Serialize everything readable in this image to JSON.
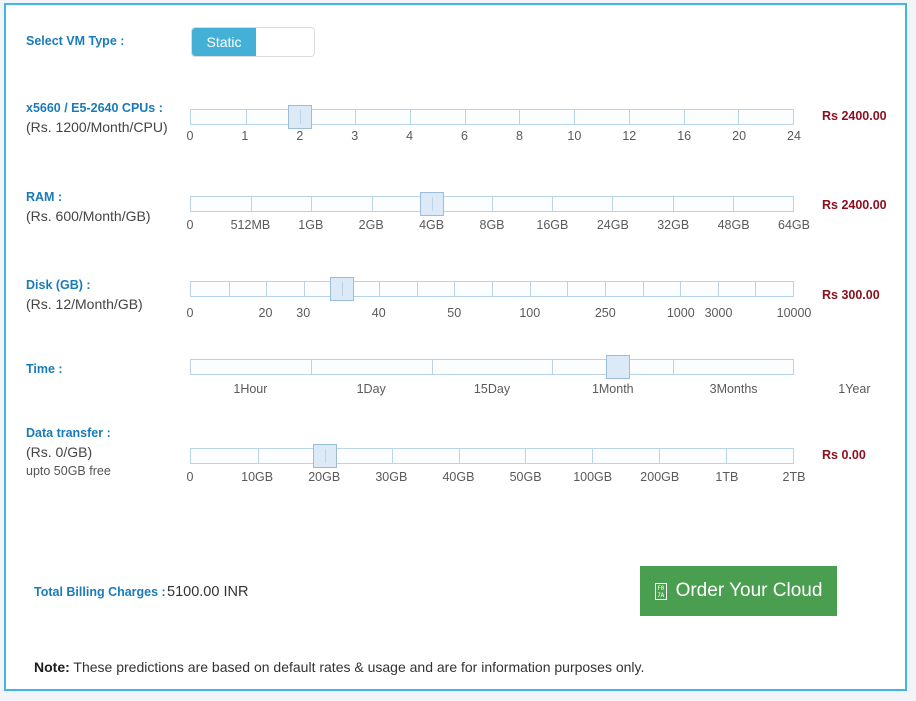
{
  "vm_type": {
    "label": "Select VM Type :",
    "selected": "Static"
  },
  "rows": [
    {
      "name": "cpu",
      "label": "x5660 / E5-2640 CPUs :",
      "rate": "(Rs. 1200/Month/CPU)",
      "price": "Rs 2400.00",
      "value": "2",
      "ticks": [
        "0",
        "1",
        "2",
        "3",
        "4",
        "6",
        "8",
        "10",
        "12",
        "16",
        "20",
        "24"
      ]
    },
    {
      "name": "ram",
      "label": "RAM :",
      "rate": "(Rs. 600/Month/GB)",
      "price": "Rs 2400.00",
      "value": "4GB",
      "ticks": [
        "0",
        "512MB",
        "1GB",
        "2GB",
        "4GB",
        "8GB",
        "16GB",
        "24GB",
        "32GB",
        "48GB",
        "64GB"
      ]
    },
    {
      "name": "disk",
      "label": "Disk (GB) :",
      "rate": "(Rs. 12/Month/GB)",
      "price": "Rs 300.00",
      "value": "25",
      "ticks": [
        "0",
        "20",
        "30",
        "40",
        "50",
        "100",
        "250",
        "1000",
        "3000",
        "10000"
      ]
    },
    {
      "name": "time",
      "label": "Time :",
      "rate": "",
      "price": "",
      "value": "1Month",
      "ticks": [
        "1Hour",
        "1Day",
        "15Day",
        "1Month",
        "3Months",
        "1Year"
      ]
    },
    {
      "name": "data-transfer",
      "label": "Data transfer :",
      "rate": "(Rs. 0/GB)",
      "note": "upto 50GB free",
      "price": "Rs 0.00",
      "value": "20GB",
      "ticks": [
        "0",
        "10GB",
        "20GB",
        "30GB",
        "40GB",
        "50GB",
        "100GB",
        "200GB",
        "1TB",
        "2TB"
      ]
    }
  ],
  "total": {
    "label": "Total Billing Charges :",
    "value": "5100.00 INR"
  },
  "order_button": {
    "label": "Order Your Cloud",
    "icon": "shopping-cart-icon",
    "icon_codepoint_top": "F0",
    "icon_codepoint_bottom": "7A",
    "color": "#4a9e50"
  },
  "footer_note": {
    "prefix": "Note:",
    "text": " These predictions are based on default rates & usage and are for information purposes only."
  },
  "colors": {
    "accent": "#3fb6e3",
    "label": "#1a7bb9",
    "price": "#8d0f1e",
    "toggle_on": "#45b0d6"
  }
}
